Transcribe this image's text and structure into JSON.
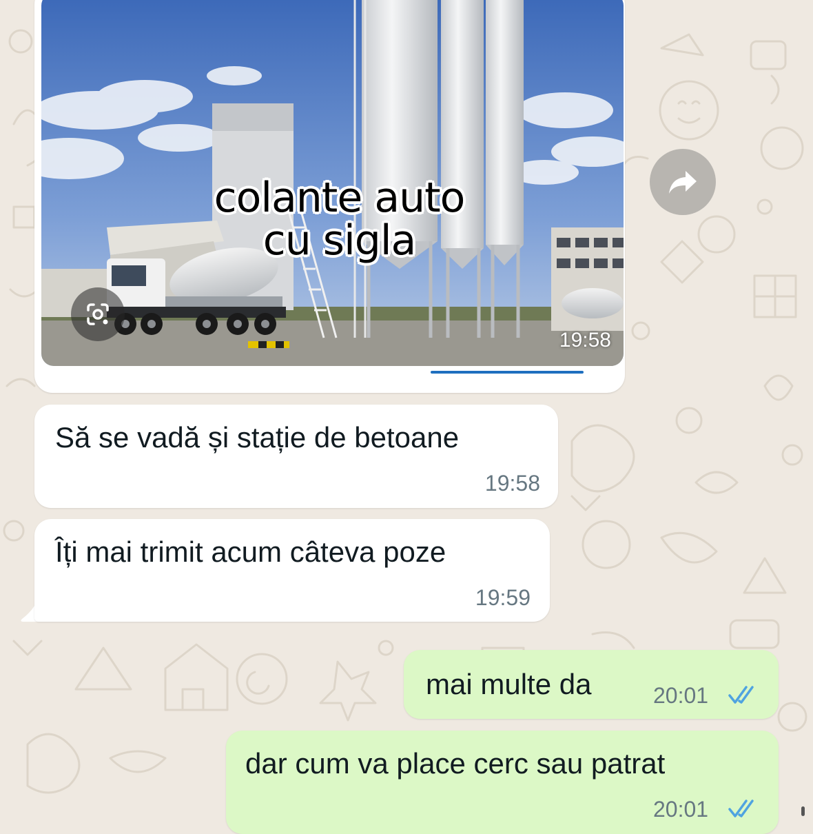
{
  "messages": [
    {
      "type": "image",
      "direction": "incoming",
      "caption_line1": "colante auto",
      "caption_line2": "cu sigla",
      "time": "19:58"
    },
    {
      "type": "text",
      "direction": "incoming",
      "text": "Să se vadă și stație de betoane",
      "time": "19:58"
    },
    {
      "type": "text",
      "direction": "incoming",
      "text": "Îți mai trimit acum câteva poze",
      "time": "19:59"
    },
    {
      "type": "text",
      "direction": "outgoing",
      "text": "mai multe da",
      "time": "20:01",
      "status": "read"
    },
    {
      "type": "text",
      "direction": "outgoing",
      "text": "dar cum va place cerc sau patrat",
      "time": "20:01",
      "status": "read"
    }
  ],
  "icons": {
    "forward": "forward-arrow-icon",
    "lens": "visual-search-icon",
    "read_receipt": "double-check-icon"
  },
  "colors": {
    "wallpaper": "#efe9e1",
    "incoming_bubble": "#ffffff",
    "outgoing_bubble": "#dcf8c6",
    "read_ticks": "#4fa3e0"
  }
}
